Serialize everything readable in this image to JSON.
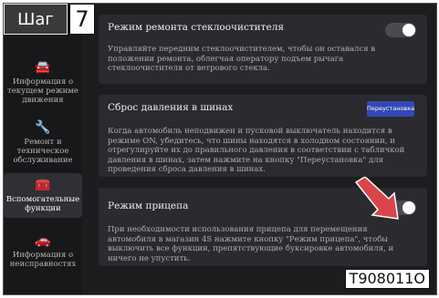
{
  "step": {
    "word": "Шаг",
    "number": "7"
  },
  "sidebar": {
    "items": [
      {
        "icon": "car-info-icon",
        "label": "Информация о текущем режиме движения"
      },
      {
        "icon": "wrench-icon",
        "label": "Ремонт и техническое обслуживание"
      },
      {
        "icon": "toolbox-icon",
        "label": "Вспомогательные функции"
      },
      {
        "icon": "car-fault-icon",
        "label": "Информация о неисправностях"
      }
    ]
  },
  "wiper": {
    "title": "Режим ремонта стеклоочистителя",
    "desc": "Управляйте передним стеклоочистителем, чтобы он оставался в положении ремонта, облегчая оператору подъем рычага стеклоочистителя от ветрового стекла."
  },
  "tire": {
    "title": "Сброс давления в шинах",
    "button": "Переустановка",
    "desc": "Когда автомобиль неподвижен и пусковой выключатель находится в режиме ON, убедитесь, что шины находятся в холодном состоянии, и отрегулируйте их до правильного давления в соответствии с табличкой давления в шинах, затем нажмите на кнопку \"Переустановка\" для проведения сброса давления в шинах."
  },
  "trailer": {
    "title": "Режим прицепа",
    "desc": "При необходимости использования прицепа для перемещения автомобиля в магазин 4S нажмите кнопку \"Режим прицепа\", чтобы выключить все функции, препятствующие буксировке автомобиля, и ничего не упустить."
  },
  "figure_code": "T908011O",
  "colors": {
    "accent": "#3348b4",
    "arrow": "#d9454a"
  }
}
